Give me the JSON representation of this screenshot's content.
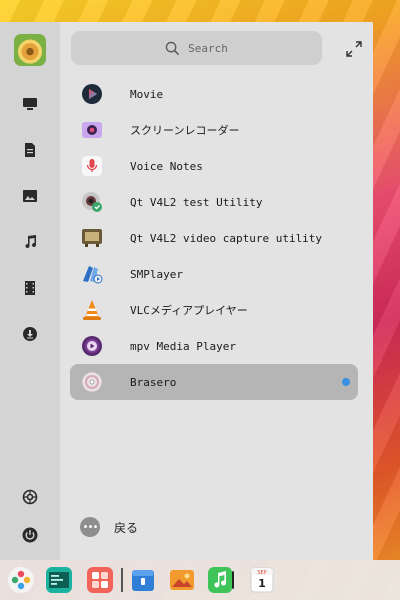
{
  "search": {
    "placeholder": "Search"
  },
  "sidebar": {
    "icons": [
      "computer-icon",
      "document-icon",
      "picture-icon",
      "music-icon",
      "video-icon",
      "download-icon",
      "settings-icon",
      "power-icon"
    ]
  },
  "apps": [
    {
      "label": "Movie",
      "icon": "movie-icon"
    },
    {
      "label": "スクリーンレコーダー",
      "icon": "screen-recorder-icon"
    },
    {
      "label": "Voice Notes",
      "icon": "voice-notes-icon"
    },
    {
      "label": "Qt V4L2 test Utility",
      "icon": "qt-v4l2-test-icon"
    },
    {
      "label": "Qt V4L2 video capture utility",
      "icon": "qt-v4l2-capture-icon"
    },
    {
      "label": "SMPlayer",
      "icon": "smplayer-icon"
    },
    {
      "label": "VLCメディアプレイヤー",
      "icon": "vlc-icon"
    },
    {
      "label": "mpv Media Player",
      "icon": "mpv-icon"
    },
    {
      "label": "Brasero",
      "icon": "brasero-icon",
      "selected": true,
      "new": true
    }
  ],
  "footer": {
    "back_label": "戻る",
    "more_glyph": "•••"
  },
  "dock": {
    "items": [
      "launcher-icon",
      "terminal-icon",
      "app-store-icon",
      "archive-icon",
      "photos-icon",
      "music-player-icon",
      "calendar-icon"
    ],
    "calendar": {
      "month": "SEP",
      "day": "1"
    }
  },
  "colors": {
    "accent": "#3a8ee6",
    "panel": "#e3e3e3",
    "sidebar": "#d4d4d4",
    "selected": "#b5b5b5"
  }
}
